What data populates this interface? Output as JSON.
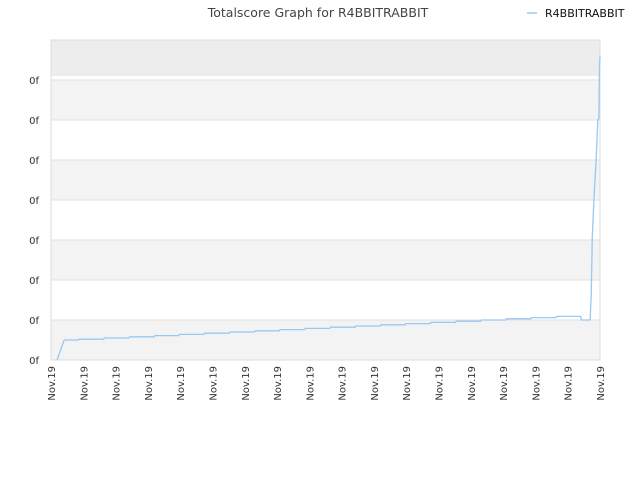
{
  "chart_data": {
    "type": "line",
    "title": "Totalscore Graph for R4BBITRABBIT",
    "legend": {
      "position": "top-right",
      "entries": [
        "R4BBITRABBIT"
      ]
    },
    "grid": true,
    "xlabel": "",
    "ylabel": "",
    "y_tick_labels": [
      "0f",
      "0f",
      "0f",
      "0f",
      "0f",
      "0f",
      "0f",
      "0f"
    ],
    "x_tick_labels": [
      "Nov.19",
      "Nov.19",
      "Nov.19",
      "Nov.19",
      "Nov.19",
      "Nov.19",
      "Nov.19",
      "Nov.19",
      "Nov.19",
      "Nov.19",
      "Nov.19",
      "Nov.19",
      "Nov.19",
      "Nov.19",
      "Nov.19",
      "Nov.19",
      "Nov.19",
      "Nov.19"
    ],
    "x_range": [
      0,
      1
    ],
    "y_range": [
      0,
      8
    ],
    "series": [
      {
        "name": "R4BBITRABBIT",
        "color": "#99c8f0",
        "x": [
          0.011,
          0.024,
          0.05,
          0.051,
          0.096,
          0.097,
          0.142,
          0.143,
          0.188,
          0.189,
          0.233,
          0.234,
          0.279,
          0.28,
          0.325,
          0.326,
          0.371,
          0.372,
          0.416,
          0.417,
          0.462,
          0.463,
          0.508,
          0.509,
          0.554,
          0.555,
          0.6,
          0.601,
          0.645,
          0.646,
          0.691,
          0.692,
          0.737,
          0.738,
          0.783,
          0.784,
          0.828,
          0.829,
          0.874,
          0.875,
          0.92,
          0.921,
          0.965,
          0.966,
          0.982,
          0.984,
          0.986,
          0.99,
          0.993,
          0.996,
          0.998,
          0.999,
          1.0
        ],
        "y": [
          0.0,
          0.5,
          0.5,
          0.52,
          0.52,
          0.55,
          0.55,
          0.58,
          0.58,
          0.61,
          0.61,
          0.64,
          0.64,
          0.67,
          0.67,
          0.7,
          0.7,
          0.73,
          0.73,
          0.76,
          0.76,
          0.79,
          0.79,
          0.82,
          0.82,
          0.85,
          0.85,
          0.88,
          0.88,
          0.91,
          0.91,
          0.94,
          0.94,
          0.97,
          0.97,
          1.0,
          1.0,
          1.03,
          1.03,
          1.06,
          1.06,
          1.09,
          1.09,
          1.0,
          1.0,
          1.6,
          3.1,
          4.3,
          5.0,
          6.0,
          6.05,
          7.3,
          7.6
        ]
      }
    ]
  }
}
